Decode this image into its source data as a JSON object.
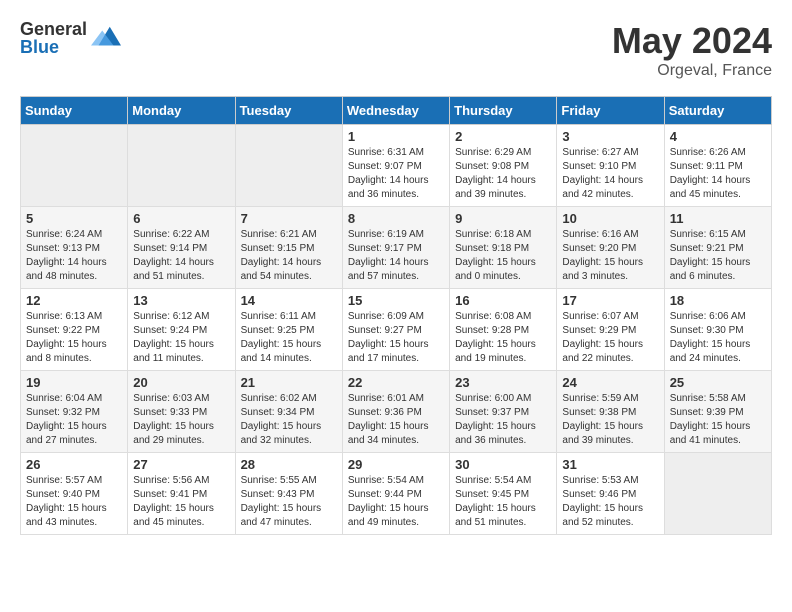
{
  "header": {
    "logo_general": "General",
    "logo_blue": "Blue",
    "month": "May 2024",
    "location": "Orgeval, France"
  },
  "days_of_week": [
    "Sunday",
    "Monday",
    "Tuesday",
    "Wednesday",
    "Thursday",
    "Friday",
    "Saturday"
  ],
  "weeks": [
    [
      {
        "day": "",
        "info": ""
      },
      {
        "day": "",
        "info": ""
      },
      {
        "day": "",
        "info": ""
      },
      {
        "day": "1",
        "info": "Sunrise: 6:31 AM\nSunset: 9:07 PM\nDaylight: 14 hours\nand 36 minutes."
      },
      {
        "day": "2",
        "info": "Sunrise: 6:29 AM\nSunset: 9:08 PM\nDaylight: 14 hours\nand 39 minutes."
      },
      {
        "day": "3",
        "info": "Sunrise: 6:27 AM\nSunset: 9:10 PM\nDaylight: 14 hours\nand 42 minutes."
      },
      {
        "day": "4",
        "info": "Sunrise: 6:26 AM\nSunset: 9:11 PM\nDaylight: 14 hours\nand 45 minutes."
      }
    ],
    [
      {
        "day": "5",
        "info": "Sunrise: 6:24 AM\nSunset: 9:13 PM\nDaylight: 14 hours\nand 48 minutes."
      },
      {
        "day": "6",
        "info": "Sunrise: 6:22 AM\nSunset: 9:14 PM\nDaylight: 14 hours\nand 51 minutes."
      },
      {
        "day": "7",
        "info": "Sunrise: 6:21 AM\nSunset: 9:15 PM\nDaylight: 14 hours\nand 54 minutes."
      },
      {
        "day": "8",
        "info": "Sunrise: 6:19 AM\nSunset: 9:17 PM\nDaylight: 14 hours\nand 57 minutes."
      },
      {
        "day": "9",
        "info": "Sunrise: 6:18 AM\nSunset: 9:18 PM\nDaylight: 15 hours\nand 0 minutes."
      },
      {
        "day": "10",
        "info": "Sunrise: 6:16 AM\nSunset: 9:20 PM\nDaylight: 15 hours\nand 3 minutes."
      },
      {
        "day": "11",
        "info": "Sunrise: 6:15 AM\nSunset: 9:21 PM\nDaylight: 15 hours\nand 6 minutes."
      }
    ],
    [
      {
        "day": "12",
        "info": "Sunrise: 6:13 AM\nSunset: 9:22 PM\nDaylight: 15 hours\nand 8 minutes."
      },
      {
        "day": "13",
        "info": "Sunrise: 6:12 AM\nSunset: 9:24 PM\nDaylight: 15 hours\nand 11 minutes."
      },
      {
        "day": "14",
        "info": "Sunrise: 6:11 AM\nSunset: 9:25 PM\nDaylight: 15 hours\nand 14 minutes."
      },
      {
        "day": "15",
        "info": "Sunrise: 6:09 AM\nSunset: 9:27 PM\nDaylight: 15 hours\nand 17 minutes."
      },
      {
        "day": "16",
        "info": "Sunrise: 6:08 AM\nSunset: 9:28 PM\nDaylight: 15 hours\nand 19 minutes."
      },
      {
        "day": "17",
        "info": "Sunrise: 6:07 AM\nSunset: 9:29 PM\nDaylight: 15 hours\nand 22 minutes."
      },
      {
        "day": "18",
        "info": "Sunrise: 6:06 AM\nSunset: 9:30 PM\nDaylight: 15 hours\nand 24 minutes."
      }
    ],
    [
      {
        "day": "19",
        "info": "Sunrise: 6:04 AM\nSunset: 9:32 PM\nDaylight: 15 hours\nand 27 minutes."
      },
      {
        "day": "20",
        "info": "Sunrise: 6:03 AM\nSunset: 9:33 PM\nDaylight: 15 hours\nand 29 minutes."
      },
      {
        "day": "21",
        "info": "Sunrise: 6:02 AM\nSunset: 9:34 PM\nDaylight: 15 hours\nand 32 minutes."
      },
      {
        "day": "22",
        "info": "Sunrise: 6:01 AM\nSunset: 9:36 PM\nDaylight: 15 hours\nand 34 minutes."
      },
      {
        "day": "23",
        "info": "Sunrise: 6:00 AM\nSunset: 9:37 PM\nDaylight: 15 hours\nand 36 minutes."
      },
      {
        "day": "24",
        "info": "Sunrise: 5:59 AM\nSunset: 9:38 PM\nDaylight: 15 hours\nand 39 minutes."
      },
      {
        "day": "25",
        "info": "Sunrise: 5:58 AM\nSunset: 9:39 PM\nDaylight: 15 hours\nand 41 minutes."
      }
    ],
    [
      {
        "day": "26",
        "info": "Sunrise: 5:57 AM\nSunset: 9:40 PM\nDaylight: 15 hours\nand 43 minutes."
      },
      {
        "day": "27",
        "info": "Sunrise: 5:56 AM\nSunset: 9:41 PM\nDaylight: 15 hours\nand 45 minutes."
      },
      {
        "day": "28",
        "info": "Sunrise: 5:55 AM\nSunset: 9:43 PM\nDaylight: 15 hours\nand 47 minutes."
      },
      {
        "day": "29",
        "info": "Sunrise: 5:54 AM\nSunset: 9:44 PM\nDaylight: 15 hours\nand 49 minutes."
      },
      {
        "day": "30",
        "info": "Sunrise: 5:54 AM\nSunset: 9:45 PM\nDaylight: 15 hours\nand 51 minutes."
      },
      {
        "day": "31",
        "info": "Sunrise: 5:53 AM\nSunset: 9:46 PM\nDaylight: 15 hours\nand 52 minutes."
      },
      {
        "day": "",
        "info": ""
      }
    ]
  ]
}
